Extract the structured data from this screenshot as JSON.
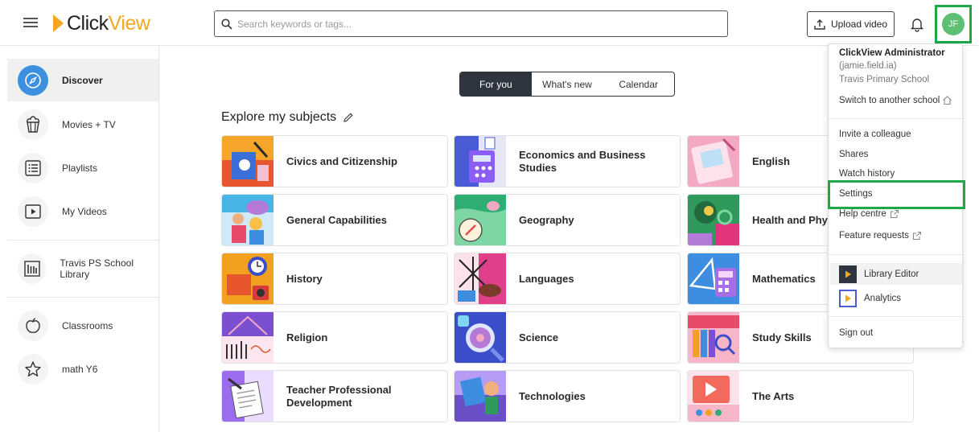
{
  "header": {
    "logo_click": "Click",
    "logo_view": "View",
    "search_placeholder": "Search keywords or tags...",
    "upload_label": "Upload video",
    "avatar_initials": "JF"
  },
  "sidebar": {
    "items": [
      {
        "label": "Discover",
        "icon": "compass-icon",
        "active": true
      },
      {
        "label": "Movies + TV",
        "icon": "popcorn-icon"
      },
      {
        "label": "Playlists",
        "icon": "list-icon"
      },
      {
        "label": "My Videos",
        "icon": "video-icon"
      },
      {
        "label": "Travis PS School Library",
        "icon": "library-icon"
      },
      {
        "label": "Classrooms",
        "icon": "apple-icon"
      },
      {
        "label": "math Y6",
        "icon": "star-icon"
      }
    ]
  },
  "tabs": [
    {
      "label": "For you",
      "active": true
    },
    {
      "label": "What's new"
    },
    {
      "label": "Calendar"
    }
  ],
  "section": {
    "title": "Explore my subjects"
  },
  "subjects": [
    {
      "label": "Civics and Citizenship",
      "color": "#e8562f"
    },
    {
      "label": "Economics and Business Studies",
      "color": "#4a5bd6"
    },
    {
      "label": "English",
      "color": "#f3a9c4"
    },
    {
      "label": "General Capabilities",
      "color": "#47b6e6"
    },
    {
      "label": "Geography",
      "color": "#2fae73"
    },
    {
      "label": "Health and Physical Education",
      "color": "#e2357d"
    },
    {
      "label": "History",
      "color": "#f2a020"
    },
    {
      "label": "Languages",
      "color": "#e23f8a"
    },
    {
      "label": "Mathematics",
      "color": "#3d8ee0"
    },
    {
      "label": "Religion",
      "color": "#7a4fd0"
    },
    {
      "label": "Science",
      "color": "#3b4ec9"
    },
    {
      "label": "Study Skills",
      "color": "#e84a6a"
    },
    {
      "label": "Teacher Professional Development",
      "color": "#9b6cf0"
    },
    {
      "label": "Technologies",
      "color": "#6b4fc8"
    },
    {
      "label": "The Arts",
      "color": "#f26a5e"
    }
  ],
  "menu": {
    "user_name": "ClickView Administrator",
    "user_id": "(jamie.field.ia)",
    "school": "Travis Primary School",
    "switch_school": "Switch to another school",
    "invite": "Invite a colleague",
    "shares": "Shares",
    "watch_history": "Watch history",
    "settings": "Settings",
    "help": "Help centre",
    "feature": "Feature requests",
    "library_editor": "Library Editor",
    "analytics": "Analytics",
    "sign_out": "Sign out"
  }
}
